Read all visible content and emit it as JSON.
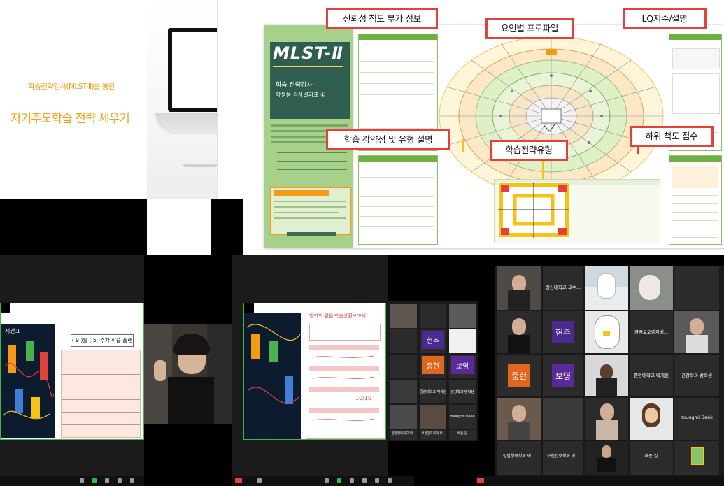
{
  "slide": {
    "subtitle": "학습전략검사(MLST-Ⅱ)를 통한",
    "title": "자기주도학습 전략 세우기"
  },
  "report": {
    "cover_title": "MLST-Ⅱ",
    "cover_subtitle1": "학습 전략검사",
    "cover_subtitle2": "학생용 검사결과표 ①",
    "callouts": {
      "reliability": "신뢰성 척도 부가 정보",
      "profile": "요인별 프로파일",
      "lq": "LQ지수/설명",
      "strengths": "학습 강약점 및 유형 설명",
      "subscale": "하위 척도 점수",
      "type": "학습전략유형"
    }
  },
  "bottom": {
    "plan_title": "( 9 )월 ( 5 )주차 학습 플랜",
    "plan_side": "시간표",
    "report_title_left": "방학의 끝을",
    "report_title_right": "학습상황보고서",
    "report_score": "10/10",
    "grid_small": {
      "names": [
        "현주",
        "중현",
        "보영"
      ],
      "colors": {
        "hyunju": "#4b2a8f",
        "junghyun": "#e0651f",
        "boyoung": "#5a2a9a"
      },
      "labels": [
        "중앙대학교 박계원",
        "건강학과 방학생",
        "Youngmi Baek",
        "정말행복학교 박...",
        "보건간호학과 박..",
        "배준 김"
      ]
    },
    "grid_large": {
      "top_name": "정신대학교 교수...",
      "kakao": "카카오오렌지베...",
      "hyunju": "현주",
      "junghyun": "중현",
      "boyoung": "보영",
      "univ": "중앙대학교 박계원",
      "health": "건강학과 방학생",
      "youngmi": "Youngmi Baek",
      "row4a": "정말행복학교 박...",
      "row4b": "보건간호학과 박...",
      "row4c": "배준 김"
    }
  }
}
